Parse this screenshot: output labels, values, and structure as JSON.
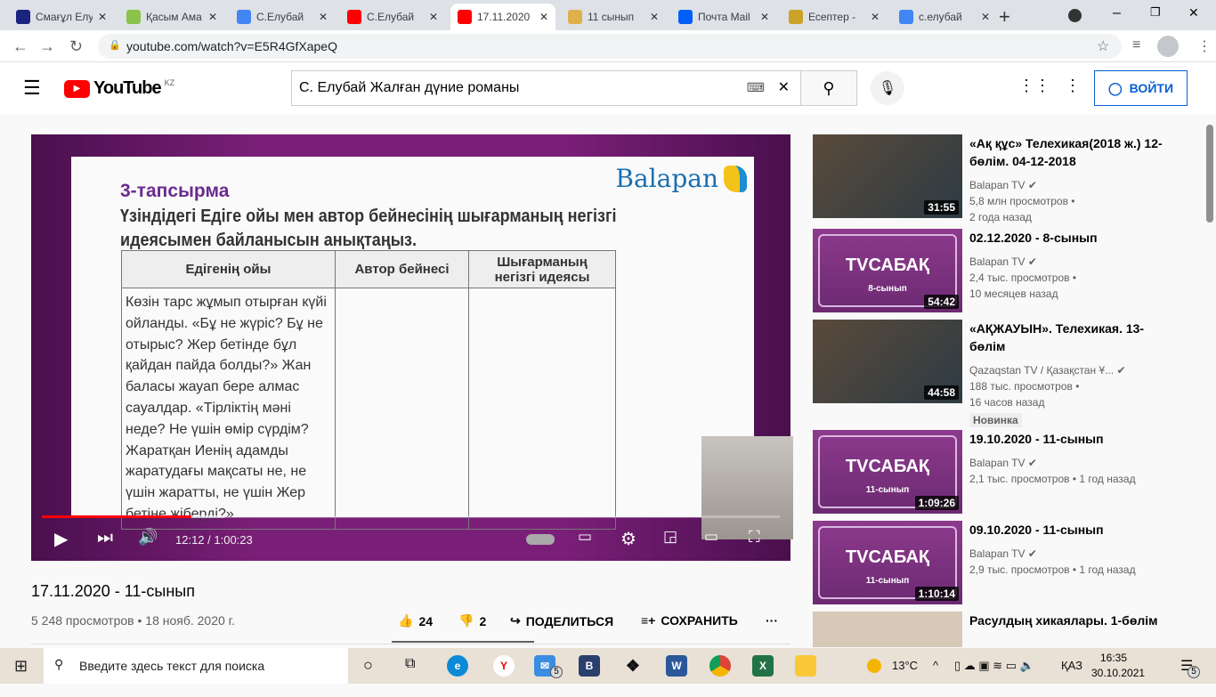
{
  "browser": {
    "tabs": [
      {
        "label": "Смағұл Елу",
        "color": "#1a237e"
      },
      {
        "label": "Қасым Ама",
        "color": "#8bc34a"
      },
      {
        "label": "С.Елубай",
        "color": "#4285f4"
      },
      {
        "label": "С.Елубай",
        "color": "#ff0000"
      },
      {
        "label": "17.11.2020",
        "color": "#ff0000"
      },
      {
        "label": "11 сынып",
        "color": "#e0b04a"
      },
      {
        "label": "Почта Mail",
        "color": "#005ff9"
      },
      {
        "label": "Есептер - ",
        "color": "#c9a227"
      },
      {
        "label": "с.елубай",
        "color": "#4285f4"
      }
    ],
    "url": "youtube.com/watch?v=E5R4GfXapeQ"
  },
  "youtube": {
    "logo": "YouTube",
    "region": "KZ",
    "search_value": "С. Елубай Жалған дүние романы",
    "signin": "ВОЙТИ"
  },
  "video": {
    "slide_task": "3-тапсырма",
    "slide_question": "Үзіндідегі Едіге ойы мен автор бейнесінің шығарманың негізгі идеясымен байланысын анықтаңыз.",
    "slide_logo": "Balapan",
    "table_headers": [
      "Едігенің ойы",
      "Автор бейнесі",
      "Шығарманың негізгі идеясы"
    ],
    "table_cell": "Көзін тарс жұмып отырған күйі ойланды. «Бұ не жүріс? Бұ не отырыс? Жер бетінде бұл қайдан пайда болды?» Жан баласы жауап бере алмас сауалдар. «Тірліктің мәні неде? Не үшін өмір сүрдім? Жаратқан Иенің адамды жаратудағы мақсаты не, не үшін жаратты, не үшін Жер бетіне жіберді?»",
    "time": "12:12 / 1:00:23",
    "progress_fraction": 0.203,
    "buffered_fraction": 0.247,
    "title": "17.11.2020 - 11-сынып",
    "meta": "5 248 просмотров • 18 нояб. 2020 г.",
    "likes": "24",
    "dislikes": "2",
    "share": "ПОДЕЛИТЬСЯ",
    "save": "СОХРАНИТЬ"
  },
  "recommendations": [
    {
      "title": "«Ақ құс» Телехикая(2018 ж.) 12-бөлім. 04-12-2018",
      "channel": "Balapan TV",
      "views": "5,8 млн просмотров •",
      "age": "2 года назад",
      "duration": "31:55"
    },
    {
      "title": "02.12.2020 - 8-сынып",
      "channel": "Balapan TV",
      "views": "2,4 тыс. просмотров •",
      "age": "10 месяцев назад",
      "duration": "54:42",
      "thumb_text": "TVСАБАҚ",
      "thumb_sub": "8-сынып"
    },
    {
      "title": "«АҚЖАУЫН». Телехикая. 13-бөлім",
      "channel": "Qazaqstan TV / Қазақстан Ұ...",
      "views": "188 тыс. просмотров •",
      "age": "16 часов назад",
      "duration": "44:58",
      "badge": "Новинка"
    },
    {
      "title": "19.10.2020 - 11-сынып",
      "channel": "Balapan TV",
      "views": "2,1 тыс. просмотров • 1 год назад",
      "duration": "1:09:26",
      "thumb_text": "TVСАБАҚ",
      "thumb_sub": "11-сынып"
    },
    {
      "title": "09.10.2020 - 11-сынып",
      "channel": "Balapan TV",
      "views": "2,9 тыс. просмотров • 1 год назад",
      "duration": "1:10:14",
      "thumb_text": "TVСАБАҚ",
      "thumb_sub": "11-сынып"
    },
    {
      "title": "Расулдың хикаялары. 1-бөлім"
    }
  ],
  "taskbar": {
    "search_placeholder": "Введите здесь текст для поиска",
    "mail_count": "5",
    "notif_count": "5",
    "weather": "13°C",
    "lang": "ҚАЗ",
    "time": "16:35",
    "date": "30.10.2021"
  }
}
